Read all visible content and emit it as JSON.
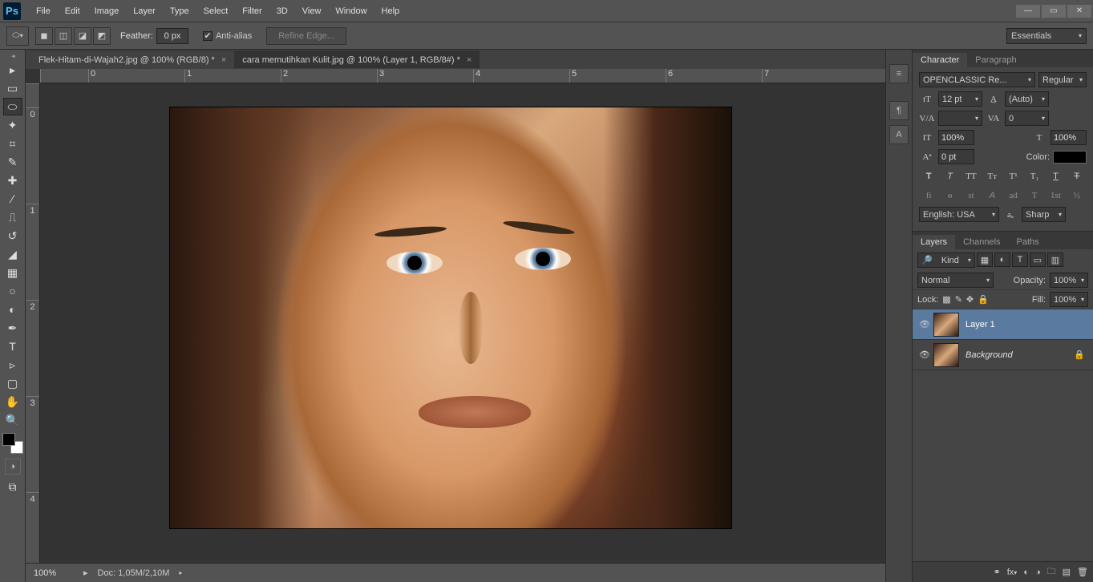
{
  "menubar": {
    "items": [
      "File",
      "Edit",
      "Image",
      "Layer",
      "Type",
      "Select",
      "Filter",
      "3D",
      "View",
      "Window",
      "Help"
    ]
  },
  "options": {
    "feather_label": "Feather:",
    "feather_value": "0 px",
    "antialias": "Anti-alias",
    "refine": "Refine Edge...",
    "workspace": "Essentials"
  },
  "tabs": [
    {
      "label": "Flek-Hitam-di-Wajah2.jpg @ 100% (RGB/8) *",
      "active": false
    },
    {
      "label": "cara memutihkan Kulit.jpg @ 100% (Layer 1, RGB/8#) *",
      "active": true
    }
  ],
  "ruler_h": [
    "0",
    "1",
    "2",
    "3",
    "4",
    "5",
    "6",
    "7"
  ],
  "ruler_v": [
    "0",
    "1",
    "2",
    "3",
    "4"
  ],
  "status": {
    "zoom": "100%",
    "doc": "Doc: 1,05M/2,10M"
  },
  "character": {
    "tab1": "Character",
    "tab2": "Paragraph",
    "font": "OPENCLASSIC Re...",
    "style": "Regular",
    "size": "12 pt",
    "leading": "(Auto)",
    "tracking": "",
    "kerning": "0",
    "hscale": "100%",
    "vscale": "100%",
    "baseline": "0 pt",
    "color_label": "Color:",
    "lang": "English: USA",
    "aa": "Sharp"
  },
  "layers": {
    "tab1": "Layers",
    "tab2": "Channels",
    "tab3": "Paths",
    "kind": "Kind",
    "blend": "Normal",
    "opacity_l": "Opacity:",
    "opacity": "100%",
    "lock_l": "Lock:",
    "fill_l": "Fill:",
    "fill": "100%",
    "items": [
      {
        "name": "Layer 1",
        "locked": false,
        "sel": true
      },
      {
        "name": "Background",
        "locked": true,
        "sel": false
      }
    ]
  }
}
